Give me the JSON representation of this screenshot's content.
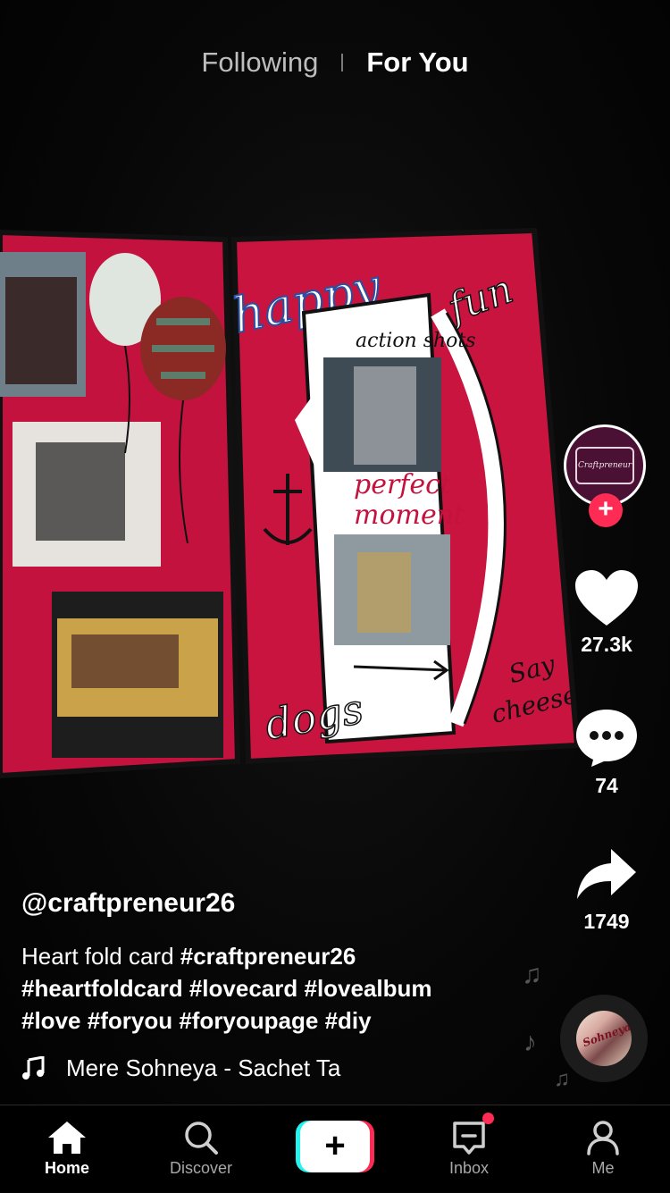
{
  "top_tabs": {
    "following": "Following",
    "for_you": "For You"
  },
  "creator": {
    "avatar_text": "Craftpreneur"
  },
  "actions": {
    "likes": "27.3k",
    "comments": "74",
    "shares": "1749"
  },
  "caption": {
    "username": "@craftpreneur26",
    "text": "Heart fold card",
    "hashtags": [
      "#craftpreneur26",
      "#heartfoldcard",
      "#lovecard",
      "#lovealbum",
      "#love",
      "#foryou",
      "#foryoupage",
      "#diy"
    ],
    "music": "Mere Sohneya - Sachet Ta"
  },
  "disc": {
    "cover_text": "Sohneya"
  },
  "card": {
    "happy": "happy",
    "fun": "fun",
    "action_shots": "action shots",
    "perfect": "perfect",
    "moment": "moment",
    "dogs": "dogs",
    "say": "Say",
    "cheese": "cheese"
  },
  "bottom_nav": {
    "home": "Home",
    "discover": "Discover",
    "inbox": "Inbox",
    "me": "Me"
  },
  "colors": {
    "accent": "#fe2c55",
    "cyan": "#25f4ee",
    "card_red": "#c4123e"
  }
}
